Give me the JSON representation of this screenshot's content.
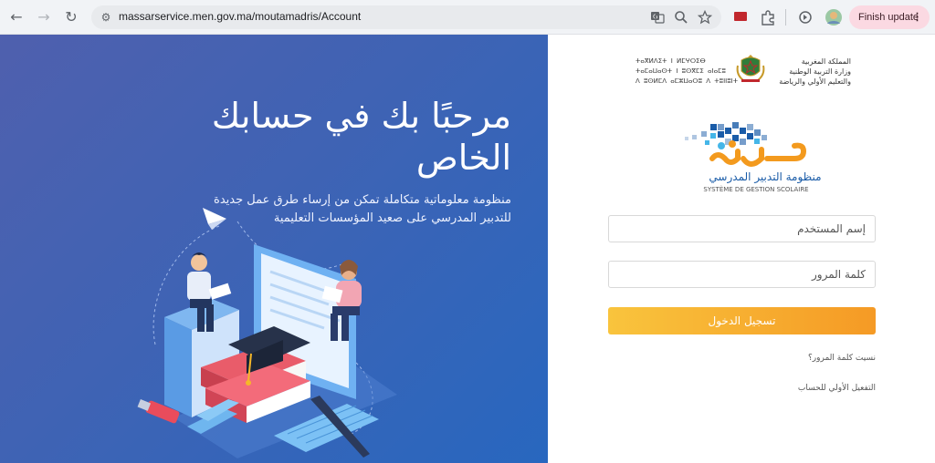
{
  "browser": {
    "url": "massarservice.men.gov.ma/moutamadris/Account",
    "update_label": "Finish update",
    "icons": [
      "back-icon",
      "forward-icon",
      "reload-icon",
      "site-settings-icon",
      "translate-icon",
      "zoom-icon",
      "bookmark-star-icon",
      "extension-flag-icon",
      "extensions-puzzle-icon",
      "sync-icon",
      "profile-avatar-icon",
      "more-menu-icon"
    ]
  },
  "hero": {
    "title": "مرحبًا بك في حسابك الخاص",
    "description": "منظومة معلوماتية متكاملة تمكن من إرساء طرق عمل جديدة للتدبير المدرسي على صعيد المؤسسات التعليمية"
  },
  "header": {
    "tifinagh_lines": [
      "ⵜⴰⴳⵍⴷⵉⵜ ⵏ ⵍⵎⵖⵔⵉⴱ",
      "ⵜⴰⵎⴰⵡⴰⵙⵜ ⵏ ⵓⵙⴳⵎⵉ ⴰⵏⴰⵎⵓ",
      "ⴷ ⵓⵙⵍⵎⴷ ⴰⵎⵣⵡⴰⵔⵓ ⴷ ⵜⵓⵏⵏⵓⵏⵜ"
    ],
    "arabic_lines": [
      "المملكة المغربية",
      "وزارة التربية الوطنية",
      "والتعليم الأولي والرياضة"
    ]
  },
  "logo": {
    "name": "مسار",
    "subtitle_ar": "منظومة التدبير المدرسي",
    "subtitle_fr": "SYSTÈME DE GESTION SCOLAIRE"
  },
  "form": {
    "username_placeholder": "إسم المستخدم",
    "password_placeholder": "كلمة المرور",
    "login_label": "تسجيل الدخول",
    "forgot_password": "نسيت كلمة المرور؟",
    "first_activation": "التفعيل الأولي للحساب"
  },
  "colors": {
    "hero_gradient_start": "#4f60ae",
    "hero_gradient_end": "#2867bf",
    "button_start": "#f9c43d",
    "button_end": "#f59a25",
    "logo_orange": "#f39a1e",
    "logo_blue": "#1a5ca8"
  }
}
